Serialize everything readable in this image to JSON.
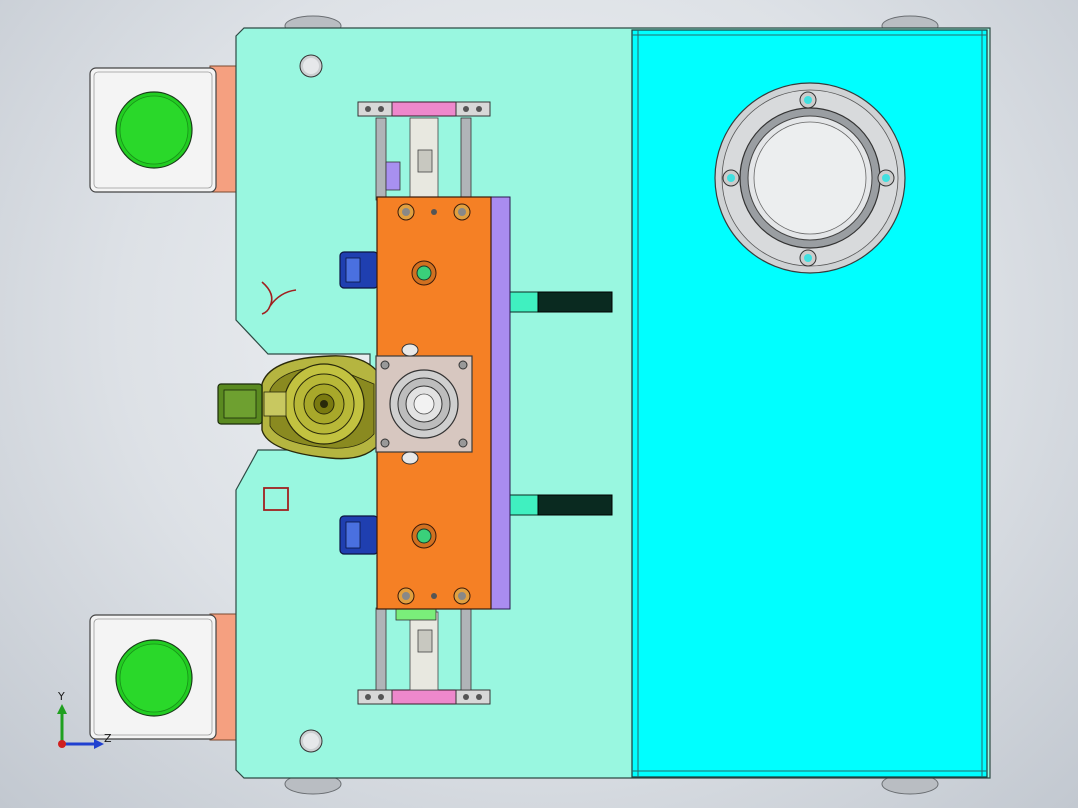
{
  "viewport": {
    "background_top": "#f2f4f6",
    "background_bottom": "#c2c8d0"
  },
  "colors": {
    "base_plate": "#99f7e0",
    "side_block": "#00ffff",
    "slide_block": "#f58025",
    "push_button": "#22cc22",
    "button_housing": "#f4f4f4",
    "spacer": "#f5a080",
    "clamp": "#1f3fb0",
    "guide_rail": "#a98cf0",
    "stop_block_dark": "#0a2a20",
    "stop_block_light": "#40f0c0",
    "end_bracket": "#ee88cc",
    "motor_housing": "#b5b540",
    "connector": "#5a8a20",
    "bearing_plate": "#d7c7c0",
    "flange": "#c8c8c8"
  },
  "sketch_marks": {
    "lambda_glyph": "Y",
    "box_glyph": "口"
  },
  "triad": {
    "y_label": "Y",
    "z_label": "Z"
  }
}
